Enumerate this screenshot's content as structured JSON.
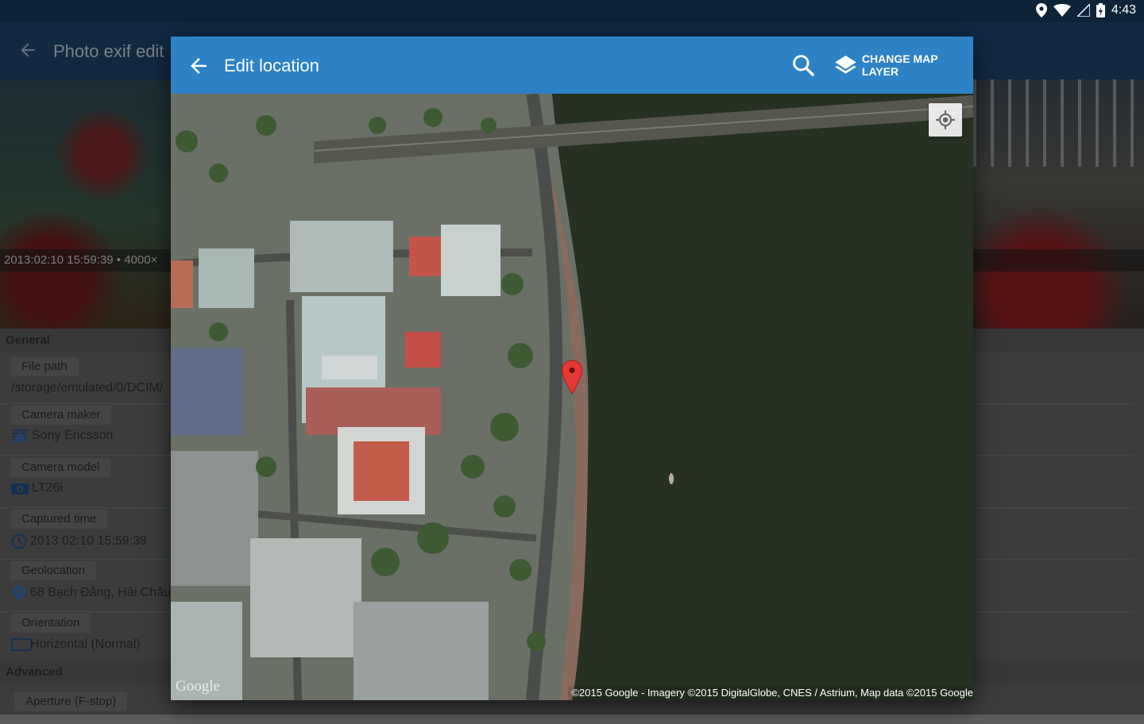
{
  "status_bar": {
    "time": "4:43"
  },
  "background_app": {
    "title": "Photo exif edit",
    "caption": "2013:02:10 15:59:39 • 4000×",
    "sections": {
      "general": "General",
      "advanced": "Advanced"
    },
    "fields": [
      {
        "label": "File path",
        "value": "/storage/emulated/0/DCIM/",
        "icon": ""
      },
      {
        "label": "Camera maker",
        "value": "Sony Ericsson",
        "icon": "maker-icon"
      },
      {
        "label": "Camera model",
        "value": "LT26i",
        "icon": "camera-icon"
      },
      {
        "label": "Captured time",
        "value": "2013:02:10 15:59:39",
        "icon": "clock-icon"
      },
      {
        "label": "Geolocation",
        "value": "68 Bạch Đằng, Hải Châu",
        "icon": "location-pin-icon"
      },
      {
        "label": "Orientation",
        "value": "Horizontal (Normal)",
        "icon": "orientation-icon"
      },
      {
        "label": "Aperture (F-stop)",
        "value": "",
        "icon": ""
      }
    ]
  },
  "dialog": {
    "title": "Edit location",
    "change_layer_label": "CHANGE MAP LAYER",
    "google_logo": "Google",
    "attribution": "©2015 Google - Imagery ©2015 DigitalGlobe, CNES / Astrium, Map data ©2015 Google"
  },
  "colors": {
    "toolbar_blue": "#2d82c6",
    "background_toolbar": "#1c4468",
    "status_bar": "#0c2338",
    "marker_red": "#e53935"
  }
}
